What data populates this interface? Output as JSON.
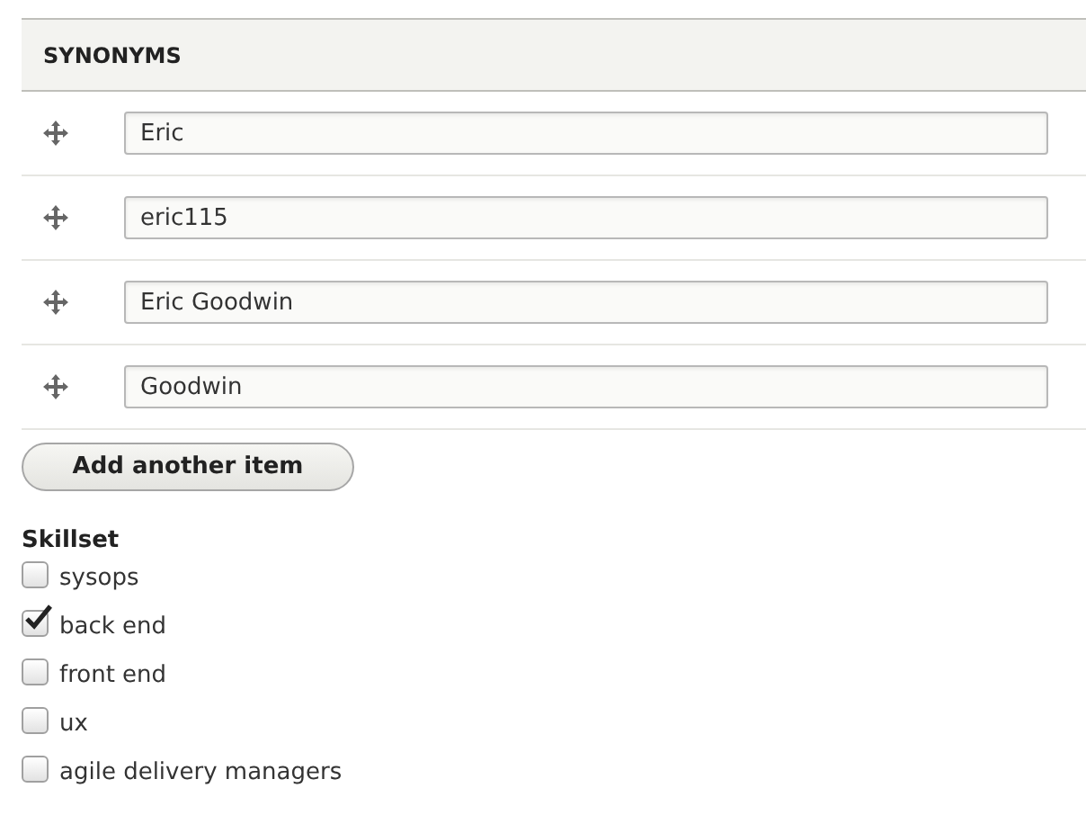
{
  "synonyms": {
    "heading": "SYNONYMS",
    "items": [
      {
        "value": "Eric"
      },
      {
        "value": "eric115"
      },
      {
        "value": "Eric Goodwin"
      },
      {
        "value": "Goodwin"
      }
    ],
    "add_button": "Add another item"
  },
  "skillset": {
    "label": "Skillset",
    "options": [
      {
        "label": "sysops",
        "checked": false
      },
      {
        "label": "back end",
        "checked": true
      },
      {
        "label": "front end",
        "checked": false
      },
      {
        "label": "ux",
        "checked": false
      },
      {
        "label": "agile delivery managers",
        "checked": false
      }
    ]
  }
}
